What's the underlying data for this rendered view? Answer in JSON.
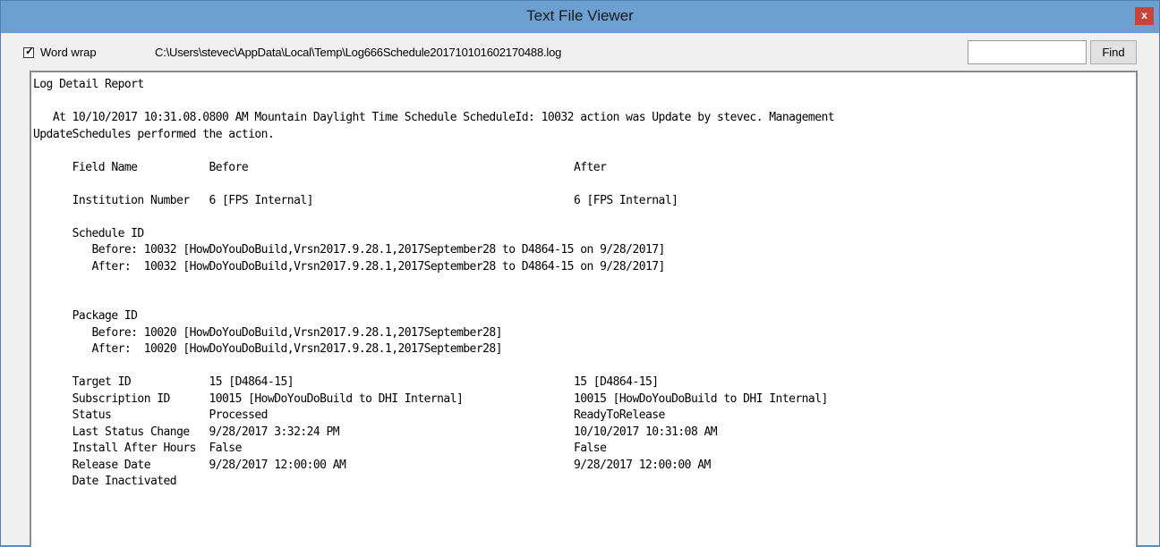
{
  "window": {
    "title": "Text File Viewer",
    "close_label": "x"
  },
  "toolbar": {
    "word_wrap_label": "Word wrap",
    "word_wrap_checked": true,
    "file_path": "C:\\Users\\stevec\\AppData\\Local\\Temp\\Log666Schedule20171010160217048 8.log",
    "find_value": "",
    "find_button_label": "Find"
  },
  "log": {
    "lines": [
      "Log Detail Report",
      "",
      "   At 10/10/2017 10:31.08.0800 AM Mountain Daylight Time Schedule ScheduleId: 10032 action was Update by stevec. Management",
      "UpdateSchedules performed the action.",
      "",
      "      Field Name           Before                                                  After",
      "",
      "      Institution Number   6 [FPS Internal]                                        6 [FPS Internal]",
      "",
      "      Schedule ID",
      "         Before: 10032 [HowDoYouDoBuild,Vrsn2017.9.28.1,2017September28 to D4864-15 on 9/28/2017]",
      "         After:  10032 [HowDoYouDoBuild,Vrsn2017.9.28.1,2017September28 to D4864-15 on 9/28/2017]",
      "",
      "",
      "      Package ID",
      "         Before: 10020 [HowDoYouDoBuild,Vrsn2017.9.28.1,2017September28]",
      "         After:  10020 [HowDoYouDoBuild,Vrsn2017.9.28.1,2017September28]",
      "",
      "      Target ID            15 [D4864-15]                                           15 [D4864-15]",
      "      Subscription ID      10015 [HowDoYouDoBuild to DHI Internal]                 10015 [HowDoYouDoBuild to DHI Internal]",
      "      Status               Processed                                               ReadyToRelease",
      "      Last Status Change   9/28/2017 3:32:24 PM                                    10/10/2017 10:31:08 AM",
      "      Install After Hours  False                                                   False",
      "      Release Date         9/28/2017 12:00:00 AM                                   9/28/2017 12:00:00 AM",
      "      Date Inactivated"
    ]
  }
}
